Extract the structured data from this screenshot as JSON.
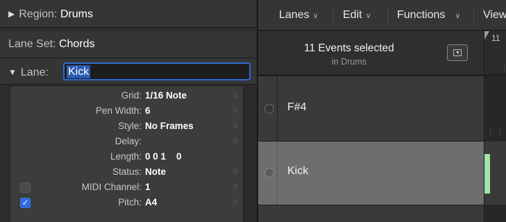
{
  "inspector": {
    "region": {
      "label": "Region:",
      "value": "Drums"
    },
    "lane_set": {
      "label": "Lane Set:",
      "value": "Chords"
    },
    "lane": {
      "label": "Lane:",
      "value": "Kick"
    },
    "params": [
      {
        "label": "Grid:",
        "value": "1/16 Note",
        "stepper": true
      },
      {
        "label": "Pen Width:",
        "value": "6",
        "stepper": true
      },
      {
        "label": "Style:",
        "value": "No Frames",
        "stepper": true
      },
      {
        "label": "Delay:",
        "value": "",
        "stepper": true
      },
      {
        "label": "Length:",
        "value": "0 0 1    0",
        "stepper": false
      },
      {
        "label": "Status:",
        "value": "Note",
        "stepper": true
      },
      {
        "label": "MIDI Channel:",
        "value": "1",
        "stepper": true,
        "checkbox": false
      },
      {
        "label": "Pitch:",
        "value": "A4",
        "stepper": true,
        "checkbox": true
      }
    ]
  },
  "menubar": {
    "lanes": "Lanes",
    "edit": "Edit",
    "functions": "Functions",
    "view": "View"
  },
  "selection": {
    "title": "11 Events selected",
    "subtitle": "in Drums"
  },
  "ruler": {
    "bar": "11"
  },
  "lanes": [
    {
      "name": "F#4"
    },
    {
      "name": "Kick"
    }
  ],
  "colors": {
    "accent": "#2e6ad0",
    "note": "#9fe6a8",
    "selected_lane": "#6e6e6e"
  }
}
